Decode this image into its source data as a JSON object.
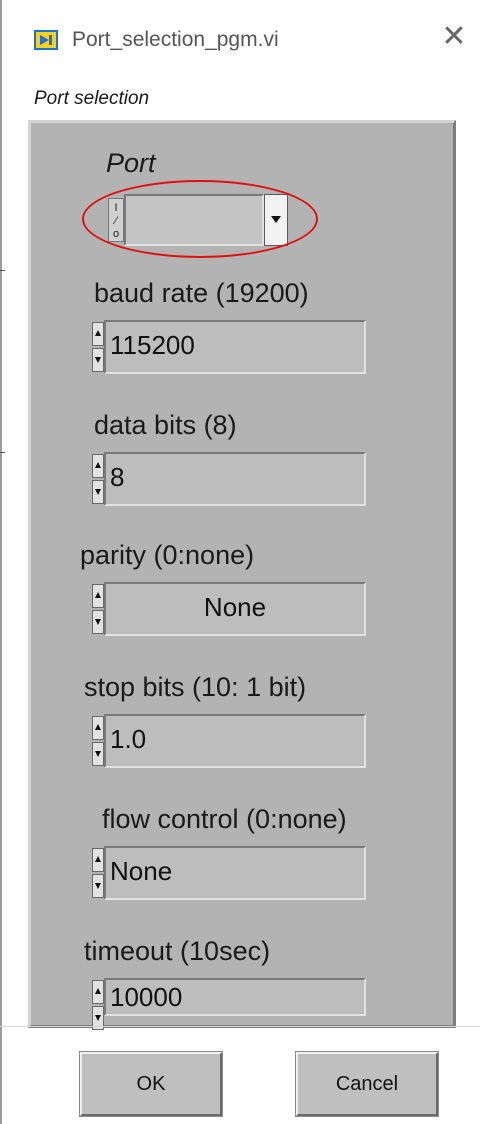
{
  "window": {
    "title": "Port_selection_pgm.vi",
    "close_glyph": "✕",
    "icon": "labview-vi-icon"
  },
  "tab_label": "Port selection",
  "controls": {
    "port": {
      "label": "Port",
      "io_glyph": "I/O",
      "value": "",
      "dropdown": "chevron-down-icon"
    },
    "baud_rate": {
      "label": "baud rate (19200)",
      "value": "115200"
    },
    "data_bits": {
      "label": "data bits (8)",
      "value": "8"
    },
    "parity": {
      "label": "parity (0:none)",
      "value": "None"
    },
    "stop_bits": {
      "label": "stop bits (10: 1 bit)",
      "value": "1.0"
    },
    "flow_control": {
      "label": "flow control (0:none)",
      "value": "None"
    },
    "timeout": {
      "label": "timeout (10sec)",
      "value": "10000"
    }
  },
  "buttons": {
    "ok": "OK",
    "cancel": "Cancel"
  },
  "colors": {
    "panel_bg": "#b3b3b3",
    "field_bg": "#bdbdbd",
    "highlight": "#e01010"
  }
}
